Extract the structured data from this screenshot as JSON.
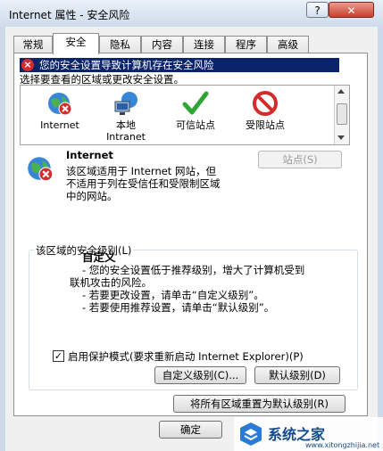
{
  "window": {
    "title": "Internet 属性 - 安全风险",
    "help_label": "?",
    "close_label": "✕"
  },
  "tabs": [
    {
      "label": "常规"
    },
    {
      "label": "安全",
      "active": true
    },
    {
      "label": "隐私"
    },
    {
      "label": "内容"
    },
    {
      "label": "连接"
    },
    {
      "label": "程序"
    },
    {
      "label": "高级"
    }
  ],
  "warning": {
    "text": "您的安全设置导致计算机存在安全风险",
    "color": "#d42c2c"
  },
  "zone_select_prompt": "选择要查看的区域或更改安全设置。",
  "zones": [
    {
      "label": "Internet",
      "icon": "globe-icon"
    },
    {
      "label": "本地\nIntranet",
      "icon": "local-intranet-icon"
    },
    {
      "label": "可信站点",
      "icon": "checkmark-icon"
    },
    {
      "label": "受限站点",
      "icon": "restricted-icon"
    }
  ],
  "selected_zone": {
    "name": "Internet",
    "description_lines": [
      "该区域适用于 Internet 网站，但",
      "不适用于列在受信任和受限制区域",
      "中的网站。"
    ],
    "sites_button": "站点(S)"
  },
  "security_level": {
    "group_label": "该区域的安全级别(L)",
    "level_name": "自定义",
    "lines": [
      "- 您的安全设置低于推荐级别，增大了计算机受到",
      "联机攻击的风险。",
      "- 若要更改设置，请单击“自定义级别”。",
      "- 若要使用推荐设置，请单击“默认级别”。"
    ]
  },
  "protected_mode": {
    "checked": true,
    "label": "启用保护模式(要求重新启动 Internet Explorer)(P)"
  },
  "buttons": {
    "custom_level": "自定义级别(C)...",
    "default_level": "默认级别(D)",
    "reset_all": "将所有区域重置为默认级别(R)",
    "ok": "确定"
  },
  "watermark": {
    "text": "系统之家",
    "url": "www.xitongzhijia.net"
  }
}
